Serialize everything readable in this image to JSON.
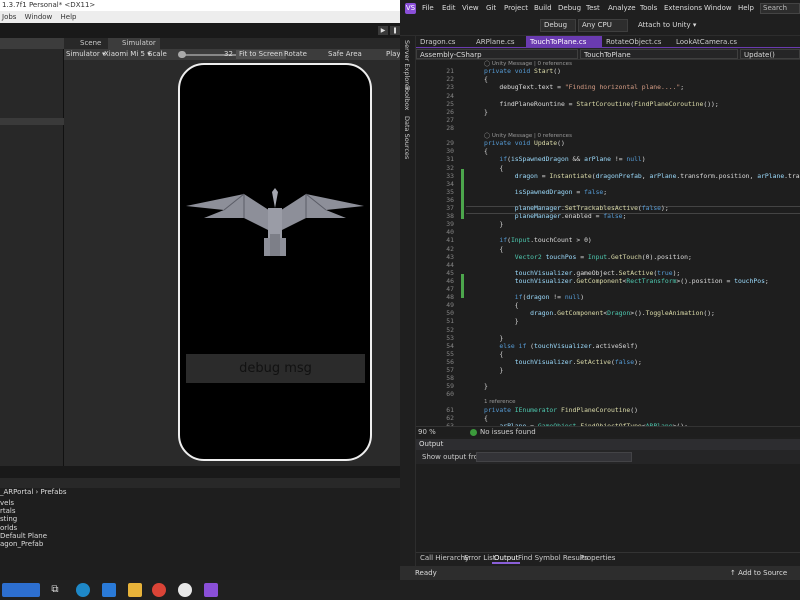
{
  "unity": {
    "title": "1.3.7f1 Personal* <DX11>",
    "menu": [
      "Jobs",
      "Window",
      "Help"
    ],
    "scene_tab": "Scene",
    "simulator_tab": "Simulator",
    "sim_bar": {
      "mode": "Simulator ▾",
      "device": "Xiaomi Mi 5 ▾",
      "scale_label": "Scale",
      "scale_value": "32",
      "fit": "Fit to Screen",
      "rotate": "Rotate",
      "safe_area": "Safe Area",
      "play": "Play"
    },
    "debug_text": "debug msg",
    "breadcrumb": "_ARPortal  › Prefabs",
    "assets": [
      "vels",
      "rtals",
      "sting",
      "orlds",
      "Default Plane",
      "agon_Prefab"
    ]
  },
  "vs": {
    "logo": "VS",
    "menu": [
      "File",
      "Edit",
      "View",
      "Git",
      "Project",
      "Build",
      "Debug",
      "Test",
      "Analyze",
      "Tools",
      "Extensions",
      "Window",
      "Help"
    ],
    "search": "Search",
    "config": "Debug",
    "platform": "Any CPU",
    "attach": "Attach to Unity ▾",
    "sidebar": [
      "Server Explorer",
      "Toolbox",
      "Data Sources"
    ],
    "tabs": [
      "Dragon.cs",
      "ARPlane.cs",
      "TouchToPlane.cs",
      "RotateObject.cs",
      "LookAtCamera.cs"
    ],
    "nav": [
      "Assembly-CSharp",
      "TouchToPlane",
      "Update()"
    ],
    "zoom": "90 %",
    "issues": "No issues found",
    "output_title": "Output",
    "output_from": "Show output from:",
    "bottom_tabs": [
      "Call Hierarchy",
      "Error List",
      "Output",
      "Find Symbol Results",
      "Properties"
    ],
    "status": "Ready",
    "status_right": "↑ Add to Source Cont"
  },
  "code": [
    {
      "n": "",
      "refs": "◯ Unity Message | 0 references"
    },
    {
      "n": "21",
      "c": "<span class='kw'>private void</span> <span class='mt'>Start</span>()"
    },
    {
      "n": "22",
      "c": "{"
    },
    {
      "n": "23",
      "c": "    debugText.text = <span class='st'>\"Finding horizontal plane....\"</span>;"
    },
    {
      "n": "24",
      "c": ""
    },
    {
      "n": "25",
      "c": "    findPlaneRountine = <span class='mt'>StartCoroutine</span>(<span class='mt'>FindPlaneCoroutine</span>());"
    },
    {
      "n": "26",
      "c": "}"
    },
    {
      "n": "27",
      "c": ""
    },
    {
      "n": "28",
      "c": ""
    },
    {
      "n": "",
      "refs": "◯ Unity Message | 0 references"
    },
    {
      "n": "29",
      "c": "<span class='kw'>private void</span> <span class='mt'>Update</span>()"
    },
    {
      "n": "30",
      "c": "{"
    },
    {
      "n": "31",
      "c": "    <span class='kw'>if</span>(<span class='fd'>isSpawnedDragon</span> &amp;&amp; <span class='fd'>arPlane</span> != <span class='kw'>null</span>)"
    },
    {
      "n": "32",
      "c": "    {"
    },
    {
      "n": "33",
      "c": "        <span class='fd'>dragon</span> = <span class='mt'>Instantiate</span>(<span class='fd'>dragonPrefab</span>, <span class='fd'>arPlane</span>.transform.position, <span class='fd'>arPlane</span>.transform"
    },
    {
      "n": "34",
      "c": ""
    },
    {
      "n": "35",
      "c": "        <span class='fd'>isSpawnedDragon</span> = <span class='kw'>false</span>;"
    },
    {
      "n": "36",
      "c": ""
    },
    {
      "n": "37",
      "c": "        <span class='fd'>planeManager</span>.<span class='mt'>SetTrackablesActive</span>(<span class='kw'>false</span>);"
    },
    {
      "n": "38",
      "c": "        <span class='fd'>planeManager</span>.enabled = <span class='kw'>false</span>;"
    },
    {
      "n": "39",
      "c": "    }"
    },
    {
      "n": "40",
      "c": ""
    },
    {
      "n": "41",
      "c": "    <span class='kw'>if</span>(<span class='ty'>Input</span>.touchCount &gt; 0)"
    },
    {
      "n": "42",
      "c": "    {"
    },
    {
      "n": "43",
      "c": "        <span class='ty'>Vector2</span> <span class='fd'>touchPos</span> = <span class='ty'>Input</span>.<span class='mt'>GetTouch</span>(0).position;"
    },
    {
      "n": "44",
      "c": ""
    },
    {
      "n": "45",
      "c": "        <span class='fd'>touchVisualizer</span>.gameObject.<span class='mt'>SetActive</span>(<span class='kw'>true</span>);"
    },
    {
      "n": "46",
      "c": "        <span class='fd'>touchVisualizer</span>.<span class='mt'>GetComponent</span>&lt;<span class='ty'>RectTransform</span>&gt;().position = <span class='fd'>touchPos</span>;"
    },
    {
      "n": "47",
      "c": ""
    },
    {
      "n": "48",
      "c": "        <span class='kw'>if</span>(<span class='fd'>dragon</span> != <span class='kw'>null</span>)"
    },
    {
      "n": "49",
      "c": "        {"
    },
    {
      "n": "50",
      "c": "            <span class='fd'>dragon</span>.<span class='mt'>GetComponent</span>&lt;<span class='ty'>Dragon</span>&gt;().<span class='mt'>ToggleAnimation</span>();"
    },
    {
      "n": "51",
      "c": "        }"
    },
    {
      "n": "52",
      "c": ""
    },
    {
      "n": "53",
      "c": "    }"
    },
    {
      "n": "54",
      "c": "    <span class='kw'>else if</span> (<span class='fd'>touchVisualizer</span>.activeSelf)"
    },
    {
      "n": "55",
      "c": "    {"
    },
    {
      "n": "56",
      "c": "        <span class='fd'>touchVisualizer</span>.<span class='mt'>SetActive</span>(<span class='kw'>false</span>);"
    },
    {
      "n": "57",
      "c": "    }"
    },
    {
      "n": "58",
      "c": ""
    },
    {
      "n": "59",
      "c": "}"
    },
    {
      "n": "60",
      "c": ""
    },
    {
      "n": "",
      "refs": "1 reference"
    },
    {
      "n": "61",
      "c": "<span class='kw'>private</span> <span class='ty'>IEnumerator</span> <span class='mt'>FindPlaneCoroutine</span>()"
    },
    {
      "n": "62",
      "c": "{"
    },
    {
      "n": "63",
      "c": "    <span class='fd'>arPlane</span> = <span class='ty'>GameObject</span>.<span class='mt'>FindObjectOfType</span>&lt;<span class='ty'>ARPlane</span>&gt;();"
    }
  ]
}
